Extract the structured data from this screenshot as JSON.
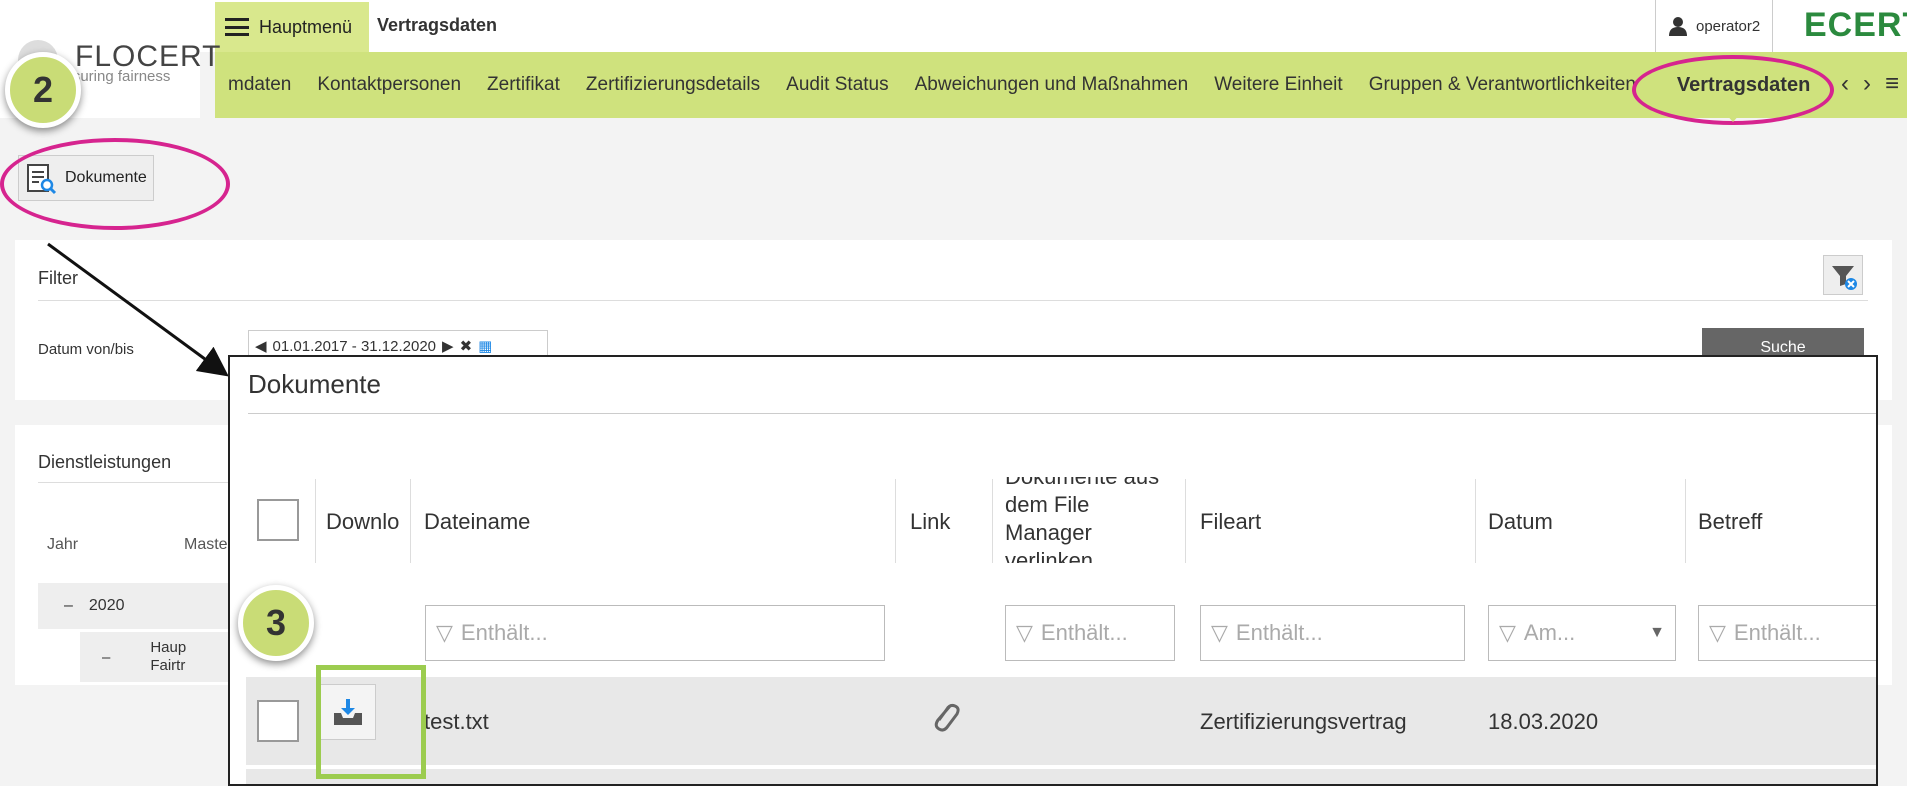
{
  "header": {
    "logo_name": "FLOCERT",
    "logo_tagline": "assuring fairness",
    "menu_label": "Hauptmenü",
    "page_title": "Vertragsdaten",
    "user": "operator2",
    "brand": "ECERT"
  },
  "nav": {
    "items": [
      "mdaten",
      "Kontaktpersonen",
      "Zertifikat",
      "Zertifizierungsdetails",
      "Audit Status",
      "Abweichungen und Maßnahmen",
      "Weitere Einheit",
      "Gruppen & Verantwortlichkeiten"
    ],
    "active": "Vertragsdaten"
  },
  "badges": {
    "step2": "2",
    "step3": "3"
  },
  "toolbar": {
    "documents_button": "Dokumente"
  },
  "filter": {
    "title": "Filter",
    "date_label": "Datum von/bis",
    "date_value": "01.01.2017 - 31.12.2020",
    "search_button": "Suche"
  },
  "services": {
    "title": "Dienstleistungen",
    "col_year": "Jahr",
    "col_master": "Maste",
    "row_year": "2020",
    "row_collapse": "–",
    "sub_collapse": "–",
    "sub_label_1": "Haup",
    "sub_label_2": "Fairtr"
  },
  "modal": {
    "title": "Dokumente",
    "columns": {
      "download": "Downlo",
      "filename": "Dateiname",
      "link": "Link",
      "file_manager_1": "Dokumente aus",
      "file_manager_2": "dem File",
      "file_manager_3": "Manager",
      "file_manager_4": "verlinken",
      "filetype": "Fileart",
      "date": "Datum",
      "subject": "Betreff"
    },
    "filters": {
      "contains": "Enthält...",
      "on": "Am..."
    },
    "rows": [
      {
        "filename": "test.txt",
        "filetype": "Zertifizierungsvertrag",
        "date": "18.03.2020"
      }
    ]
  },
  "colors": {
    "nav_green": "#cfe27d",
    "highlight": "#d6248f",
    "step_box": "#9ccc4f"
  }
}
